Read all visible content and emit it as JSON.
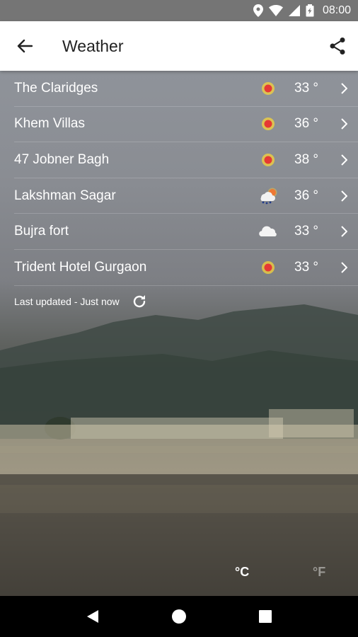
{
  "status_bar": {
    "time": "08:00"
  },
  "app_bar": {
    "title": "Weather"
  },
  "locations": [
    {
      "name": "The Claridges",
      "temp": "33 °",
      "icon": "sun-icon"
    },
    {
      "name": "Khem Villas",
      "temp": "36 °",
      "icon": "sun-icon"
    },
    {
      "name": "47 Jobner Bagh",
      "temp": "38 °",
      "icon": "sun-icon"
    },
    {
      "name": "Lakshman Sagar",
      "temp": "36 °",
      "icon": "rain-sun-icon"
    },
    {
      "name": "Bujra fort",
      "temp": "33 °",
      "icon": "cloud-icon"
    },
    {
      "name": "Trident Hotel Gurgaon",
      "temp": "33 °",
      "icon": "sun-icon"
    }
  ],
  "updated": {
    "text": "Last updated - Just now"
  },
  "units": {
    "celsius": "°C",
    "fahrenheit": "°F",
    "selected": "celsius"
  },
  "colors": {
    "sun": "#e53935",
    "sun_glow": "#fdd835",
    "status_bar": "#757575",
    "app_bar": "#ffffff"
  }
}
